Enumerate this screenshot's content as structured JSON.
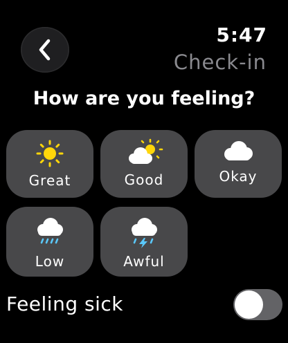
{
  "header": {
    "time": "5:47",
    "title": "Check-in"
  },
  "question": "How are you feeling?",
  "moods": [
    {
      "label": "Great",
      "icon": "sun-icon"
    },
    {
      "label": "Good",
      "icon": "sun-behind-cloud-icon"
    },
    {
      "label": "Okay",
      "icon": "cloud-icon"
    },
    {
      "label": "Low",
      "icon": "cloud-rain-icon"
    },
    {
      "label": "Awful",
      "icon": "cloud-thunderstorm-icon"
    }
  ],
  "feeling_sick": {
    "label": "Feeling sick",
    "enabled": false
  },
  "colors": {
    "background": "#000000",
    "tile": "#48484a",
    "sun": "#ffd60a",
    "rain": "#5ac8fa",
    "secondary_text": "#8a8a8f",
    "toggle_off": "#636366"
  }
}
